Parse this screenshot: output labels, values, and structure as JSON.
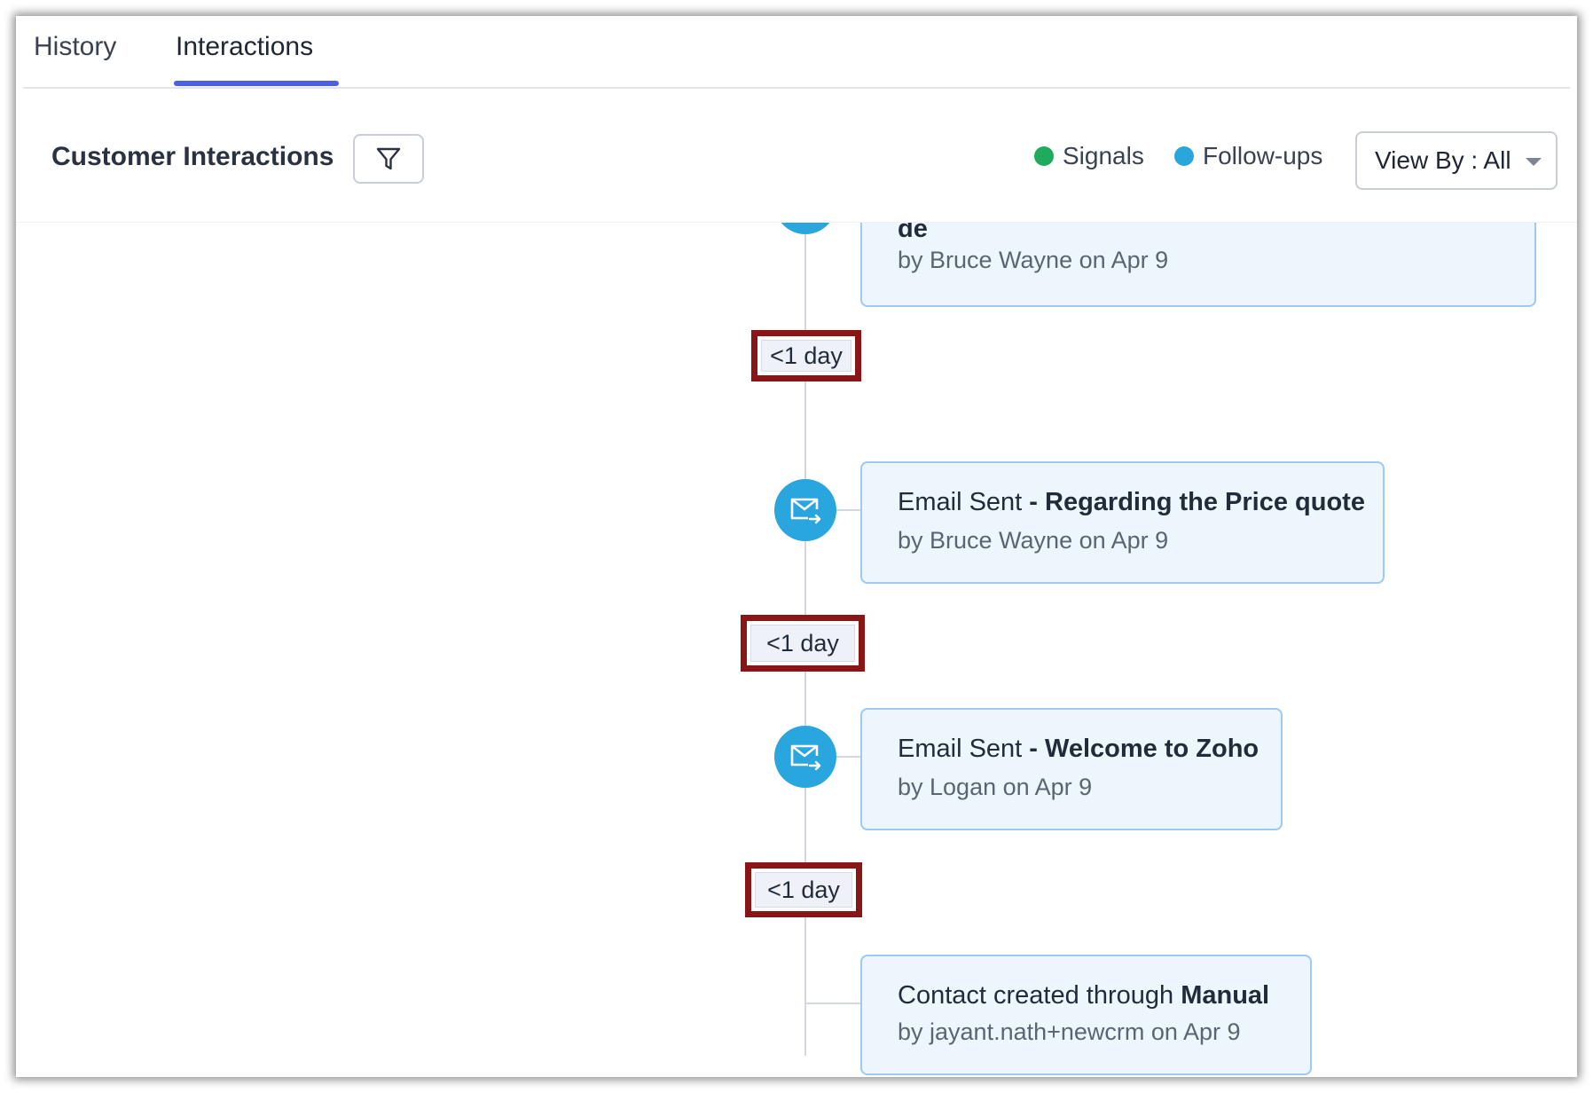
{
  "tabs": [
    {
      "label": "History",
      "active": false
    },
    {
      "label": "Interactions",
      "active": true
    }
  ],
  "header": {
    "title": "Customer Interactions",
    "filter_icon": "funnel-icon",
    "legend": [
      {
        "label": "Signals",
        "color": "#1faa5c"
      },
      {
        "label": "Follow-ups",
        "color": "#2aa6de"
      }
    ],
    "view_by_label": "View By : All"
  },
  "timeline": {
    "cards": [
      {
        "title_partial": "de",
        "subtitle": "by Bruce Wayne on Apr 9",
        "icon": "follow-up-icon"
      },
      {
        "type": "Email Sent",
        "separator": " - ",
        "subject": "Regarding the Price quote",
        "subtitle": "by Bruce Wayne on Apr 9",
        "icon": "email-sent-icon"
      },
      {
        "type": "Email Sent",
        "separator": " - ",
        "subject": "Welcome to Zoho",
        "subtitle": "by Logan on Apr 9",
        "icon": "email-sent-icon"
      },
      {
        "type": "Contact created through",
        "separator": " ",
        "subject": "Manual",
        "subtitle": "by jayant.nath+newcrm on Apr 9"
      }
    ],
    "gaps": [
      "<1 day",
      "<1 day",
      "<1 day"
    ],
    "accent_color": "#2aa6de",
    "highlight_color": "#8b1416"
  }
}
